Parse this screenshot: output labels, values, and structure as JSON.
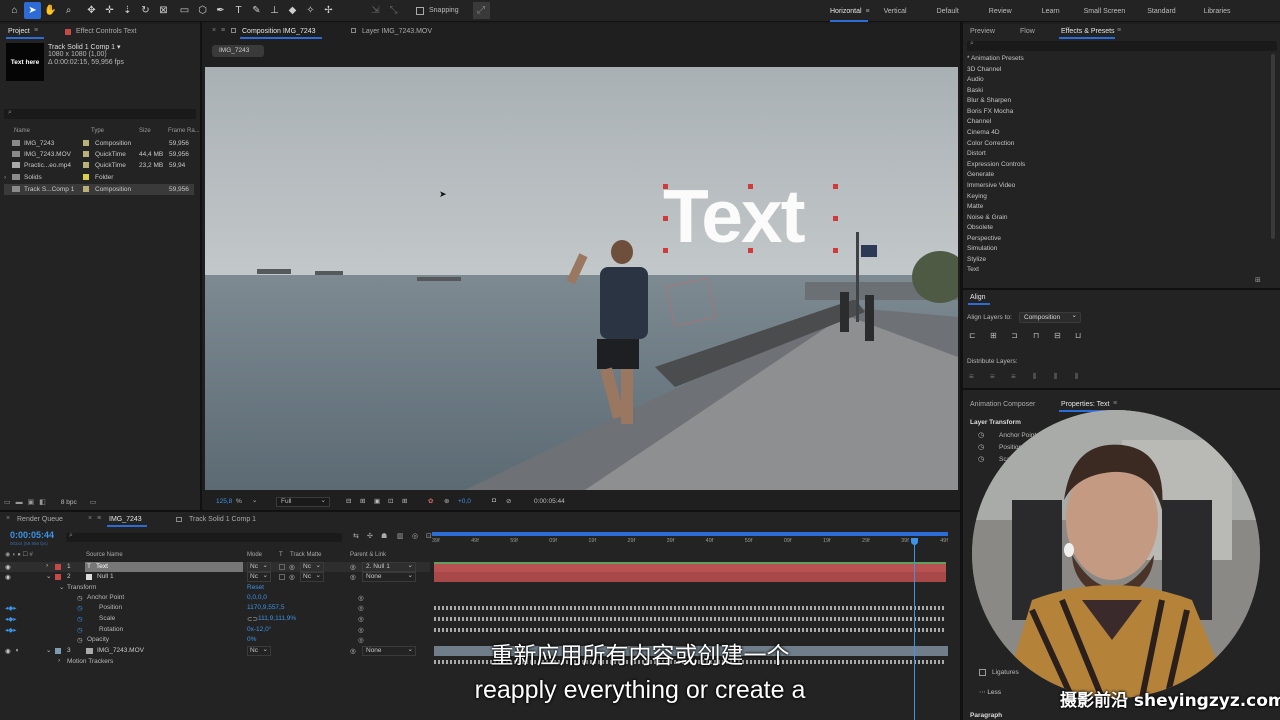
{
  "toolbar": {
    "snapping_label": "Snapping",
    "workspaces": [
      "Horizontal",
      "Vertical",
      "Default",
      "Review",
      "Learn",
      "Small Screen",
      "Standard",
      "Libraries"
    ],
    "active_workspace": "Horizontal"
  },
  "project": {
    "tab_project": "Project",
    "tab_effect_controls": "Effect Controls Text",
    "thumb_text": "Text here",
    "item_title": "Track Solid 1 Comp 1 ▾",
    "item_dims": "1080 x 1080 (1,00)",
    "item_duration": "Δ 0:00:02:15, 59,956 fps",
    "columns": {
      "name": "Name",
      "type": "Type",
      "size": "Size",
      "frame_rate": "Frame Ra..."
    },
    "items": [
      {
        "name": "IMG_7243",
        "type": "Composition",
        "size": "",
        "fps": "59,956",
        "swatch": "#b9b07a"
      },
      {
        "name": "IMG_7243.MOV",
        "type": "QuickTime",
        "size": "44,4 MB",
        "fps": "59,956",
        "swatch": "#b9b07a"
      },
      {
        "name": "Practic...eo.mp4",
        "type": "QuickTime",
        "size": "23,2 MB",
        "fps": "59,94",
        "swatch": "#b9b07a"
      },
      {
        "name": "Solids",
        "type": "Folder",
        "size": "",
        "fps": "",
        "swatch": "#d9cf4a"
      },
      {
        "name": "Track S...Comp 1",
        "type": "Composition",
        "size": "",
        "fps": "59,956",
        "swatch": "#b9b07a"
      }
    ],
    "bpc": "8 bpc"
  },
  "viewer": {
    "tab_comp": "Composition IMG_7243",
    "tab_layer": "Layer IMG_7243.MOV",
    "breadcrumb": "IMG_7243",
    "overlay_text": "Text",
    "zoom": "125,8",
    "zoom_unit": "%",
    "resolution": "Full",
    "exposure": "+0,0",
    "timecode": "0:00:05:44"
  },
  "timeline": {
    "tab_render": "Render Queue",
    "tab_comp": "IMG_7243",
    "tab_track": "Track Solid 1 Comp 1",
    "current_time": "0:00:05:44",
    "current_frames": "00344 (59.956 fps)",
    "col_source": "Source Name",
    "col_mode": "Mode",
    "col_t": "T",
    "col_trackmatte": "Track Matte",
    "col_parent": "Parent & Link",
    "ruler": [
      "39f",
      "49f",
      "59f",
      "09f",
      "19f",
      "29f",
      "39f",
      "49f",
      "59f",
      "09f",
      "19f",
      "29f",
      "39f",
      "49f"
    ],
    "layers": [
      {
        "num": "1",
        "name": "Text",
        "mode": "Nc",
        "matte": "Nc",
        "parent": "2. Null 1",
        "color": "#c44a4a"
      },
      {
        "num": "2",
        "name": "Null 1",
        "mode": "Nc",
        "matte": "Nc",
        "parent": "None",
        "color": "#c44a4a"
      },
      {
        "num": "3",
        "name": "IMG_7243.MOV",
        "mode": "Nc",
        "matte": "",
        "parent": "None",
        "color": "#7f9ab3"
      }
    ],
    "transform_label": "Transform",
    "reset_label": "Reset",
    "props": [
      {
        "name": "Anchor Point",
        "value": "0,0,0,0"
      },
      {
        "name": "Position",
        "value": "1170,9,557,5"
      },
      {
        "name": "Scale",
        "value": "111,9,111,9%"
      },
      {
        "name": "Rotation",
        "value": "0x-12,0°"
      },
      {
        "name": "Opacity",
        "value": "0%"
      }
    ],
    "motion_trackers": "Motion Trackers"
  },
  "effects": {
    "tabs": [
      "Preview",
      "Flow",
      "Effects & Presets"
    ],
    "items": [
      "* Animation Presets",
      "3D Channel",
      "Audio",
      "Baski",
      "Blur & Sharpen",
      "Boris FX Mocha",
      "Channel",
      "Cinema 4D",
      "Color Correction",
      "Distort",
      "Expression Controls",
      "Generate",
      "Immersive Video",
      "Keying",
      "Matte",
      "Noise & Grain",
      "Obsolete",
      "Perspective",
      "Simulation",
      "Stylize",
      "Text"
    ]
  },
  "align": {
    "title": "Align",
    "align_to_label": "Align Layers to:",
    "align_to_value": "Composition",
    "distribute_label": "Distribute Layers:"
  },
  "properties": {
    "tab_animation": "Animation Composer",
    "tab_properties": "Properties: Text",
    "section": "Layer Transform",
    "rows": [
      "Anchor Point",
      "Position",
      "Scale"
    ],
    "ligatures": "Ligatures",
    "less": "Less",
    "paragraph": "Paragraph"
  },
  "subtitles": {
    "chinese": "重新应用所有内容或创建一个",
    "english": "reapply everything or create a"
  },
  "watermark": "摄影前沿 sheyingzyz.com"
}
